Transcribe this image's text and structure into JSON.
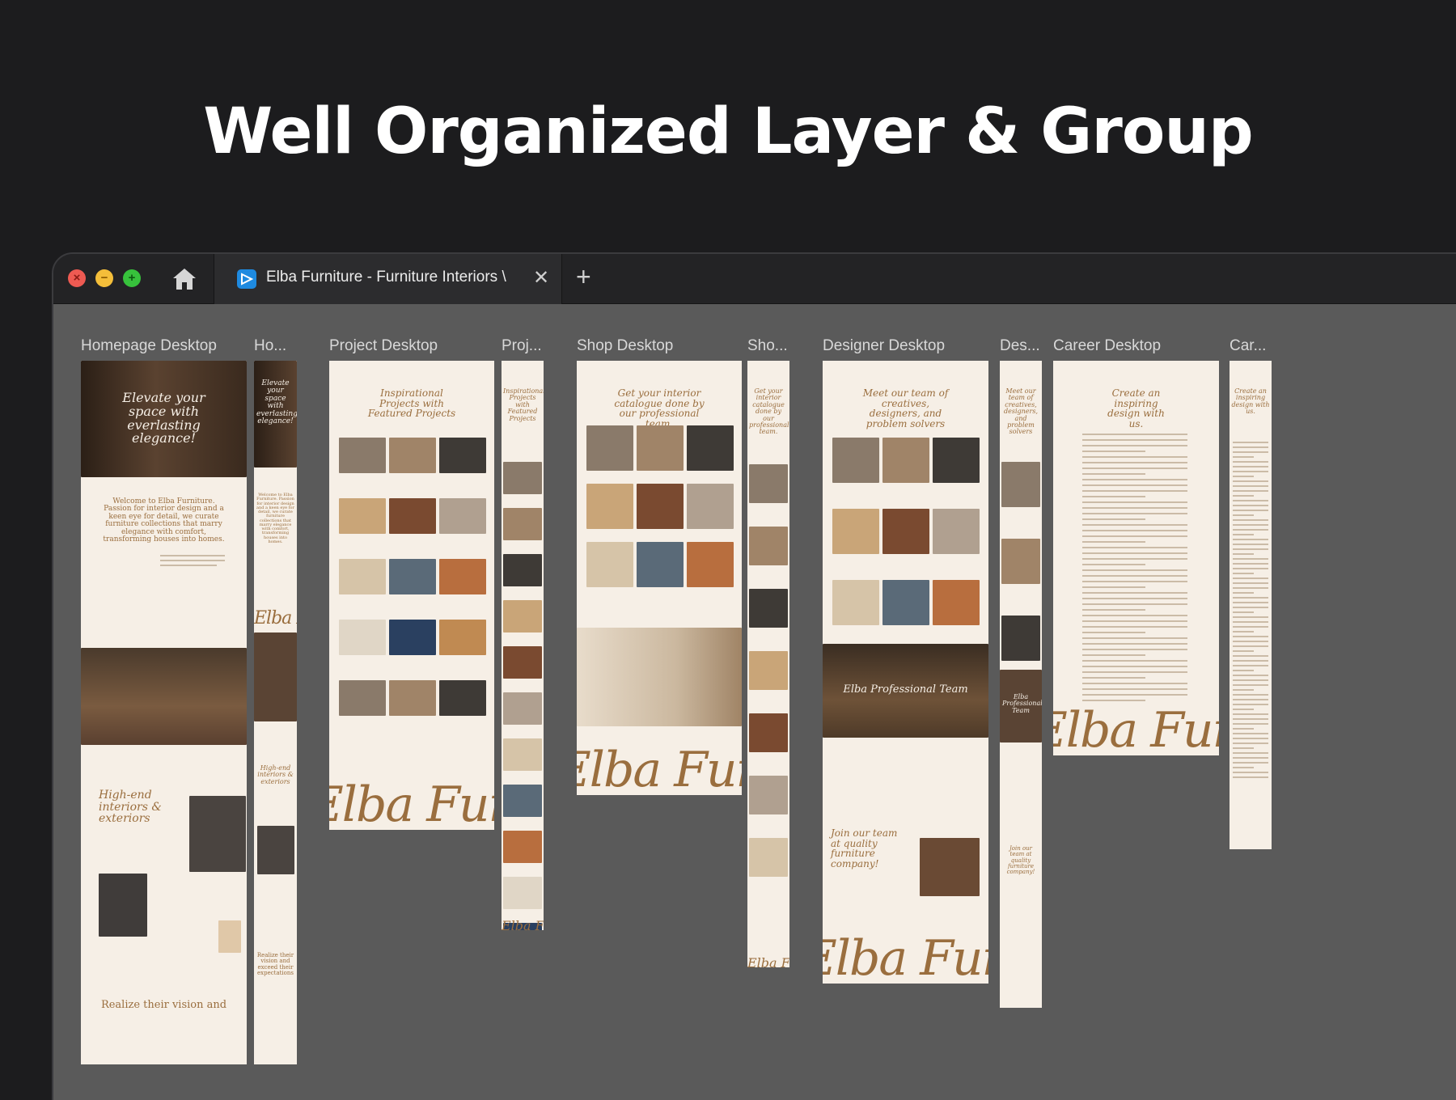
{
  "headline": "Well Organized Layer & Group",
  "window": {
    "tab_title": "Elba Furniture - Furniture Interiors \\",
    "close_glyph": "✕",
    "new_tab_glyph": "+",
    "traffic_lights": [
      "close",
      "minimize",
      "zoom"
    ]
  },
  "frames": [
    {
      "label": "Homepage Desktop",
      "heading": "Elevate your space with everlasting elegance!",
      "welcome": "Welcome to Elba Furniture. Passion for interior design and a keen eye for detail, we curate furniture collections that marry elegance with comfort, transforming houses into homes.",
      "subheading": "High-end interiors & exteriors",
      "footer_text": "Realize their vision and"
    },
    {
      "label": "Ho...",
      "heading": "Elevate your space with everlasting elegance!",
      "welcome": "Welcome to Elba Furniture. Passion for interior design and a keen eye for detail, we curate furniture collections that marry elegance with comfort, transforming houses into homes.",
      "subheading": "High-end interiors & exteriors",
      "footer_text": "Realize their vision and exceed their expectations"
    },
    {
      "label": "Project Desktop",
      "heading": "Inspirational Projects with Featured Projects"
    },
    {
      "label": "Proj...",
      "heading": "Inspirational Projects with Featured Projects"
    },
    {
      "label": "Shop Desktop",
      "heading": "Get your interior catalogue done by our professional team."
    },
    {
      "label": "Sho...",
      "heading": "Get your interior catalogue done by our professional team."
    },
    {
      "label": "Designer Desktop",
      "heading": "Meet our team of creatives, designers, and problem solvers",
      "banner": "Elba Professional Team",
      "join": "Join our team at quality furniture company!"
    },
    {
      "label": "Des...",
      "heading": "Meet our team of creatives, designers, and problem solvers",
      "banner": "Elba Professional Team",
      "join": "Join our team at quality furniture company!"
    },
    {
      "label": "Career Desktop",
      "heading": "Create an inspiring design with us."
    },
    {
      "label": "Car...",
      "heading": "Create an inspiring design with us."
    }
  ],
  "brand_wordmark": "Elba Furniture",
  "colors": {
    "canvas": "#5a5a5a",
    "frame": "#f6efe6",
    "accent": "#9a6e3e",
    "titlebar": "#232325"
  },
  "icons": [
    "close-icon",
    "minimize-icon",
    "zoom-icon",
    "home-icon",
    "favicon-icon",
    "plus-icon"
  ]
}
